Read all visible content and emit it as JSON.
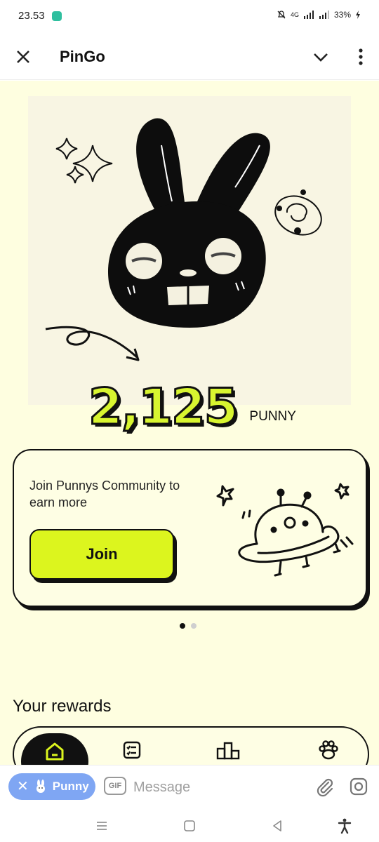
{
  "status": {
    "time": "23.53",
    "battery": "33%",
    "network": "4G"
  },
  "header": {
    "title": "PinGo"
  },
  "balance": {
    "value": "2,125",
    "unit": "PUNNY"
  },
  "promo": {
    "text": "Join Punnys Community to earn more",
    "button_label": "Join"
  },
  "carousel": {
    "page_count": 2,
    "active_index": 0
  },
  "rewards": {
    "title": "Your rewards"
  },
  "tabs": [
    {
      "icon": "home-icon"
    },
    {
      "icon": "tasks-icon"
    },
    {
      "icon": "leaderboard-icon"
    },
    {
      "icon": "squad-icon"
    }
  ],
  "composer": {
    "chip_label": "Punny",
    "gif_label": "GIF",
    "placeholder": "Message"
  },
  "colors": {
    "accent": "#dcf51e",
    "background": "#fefee0",
    "chip": "#7fa6f3",
    "ink": "#111111"
  }
}
